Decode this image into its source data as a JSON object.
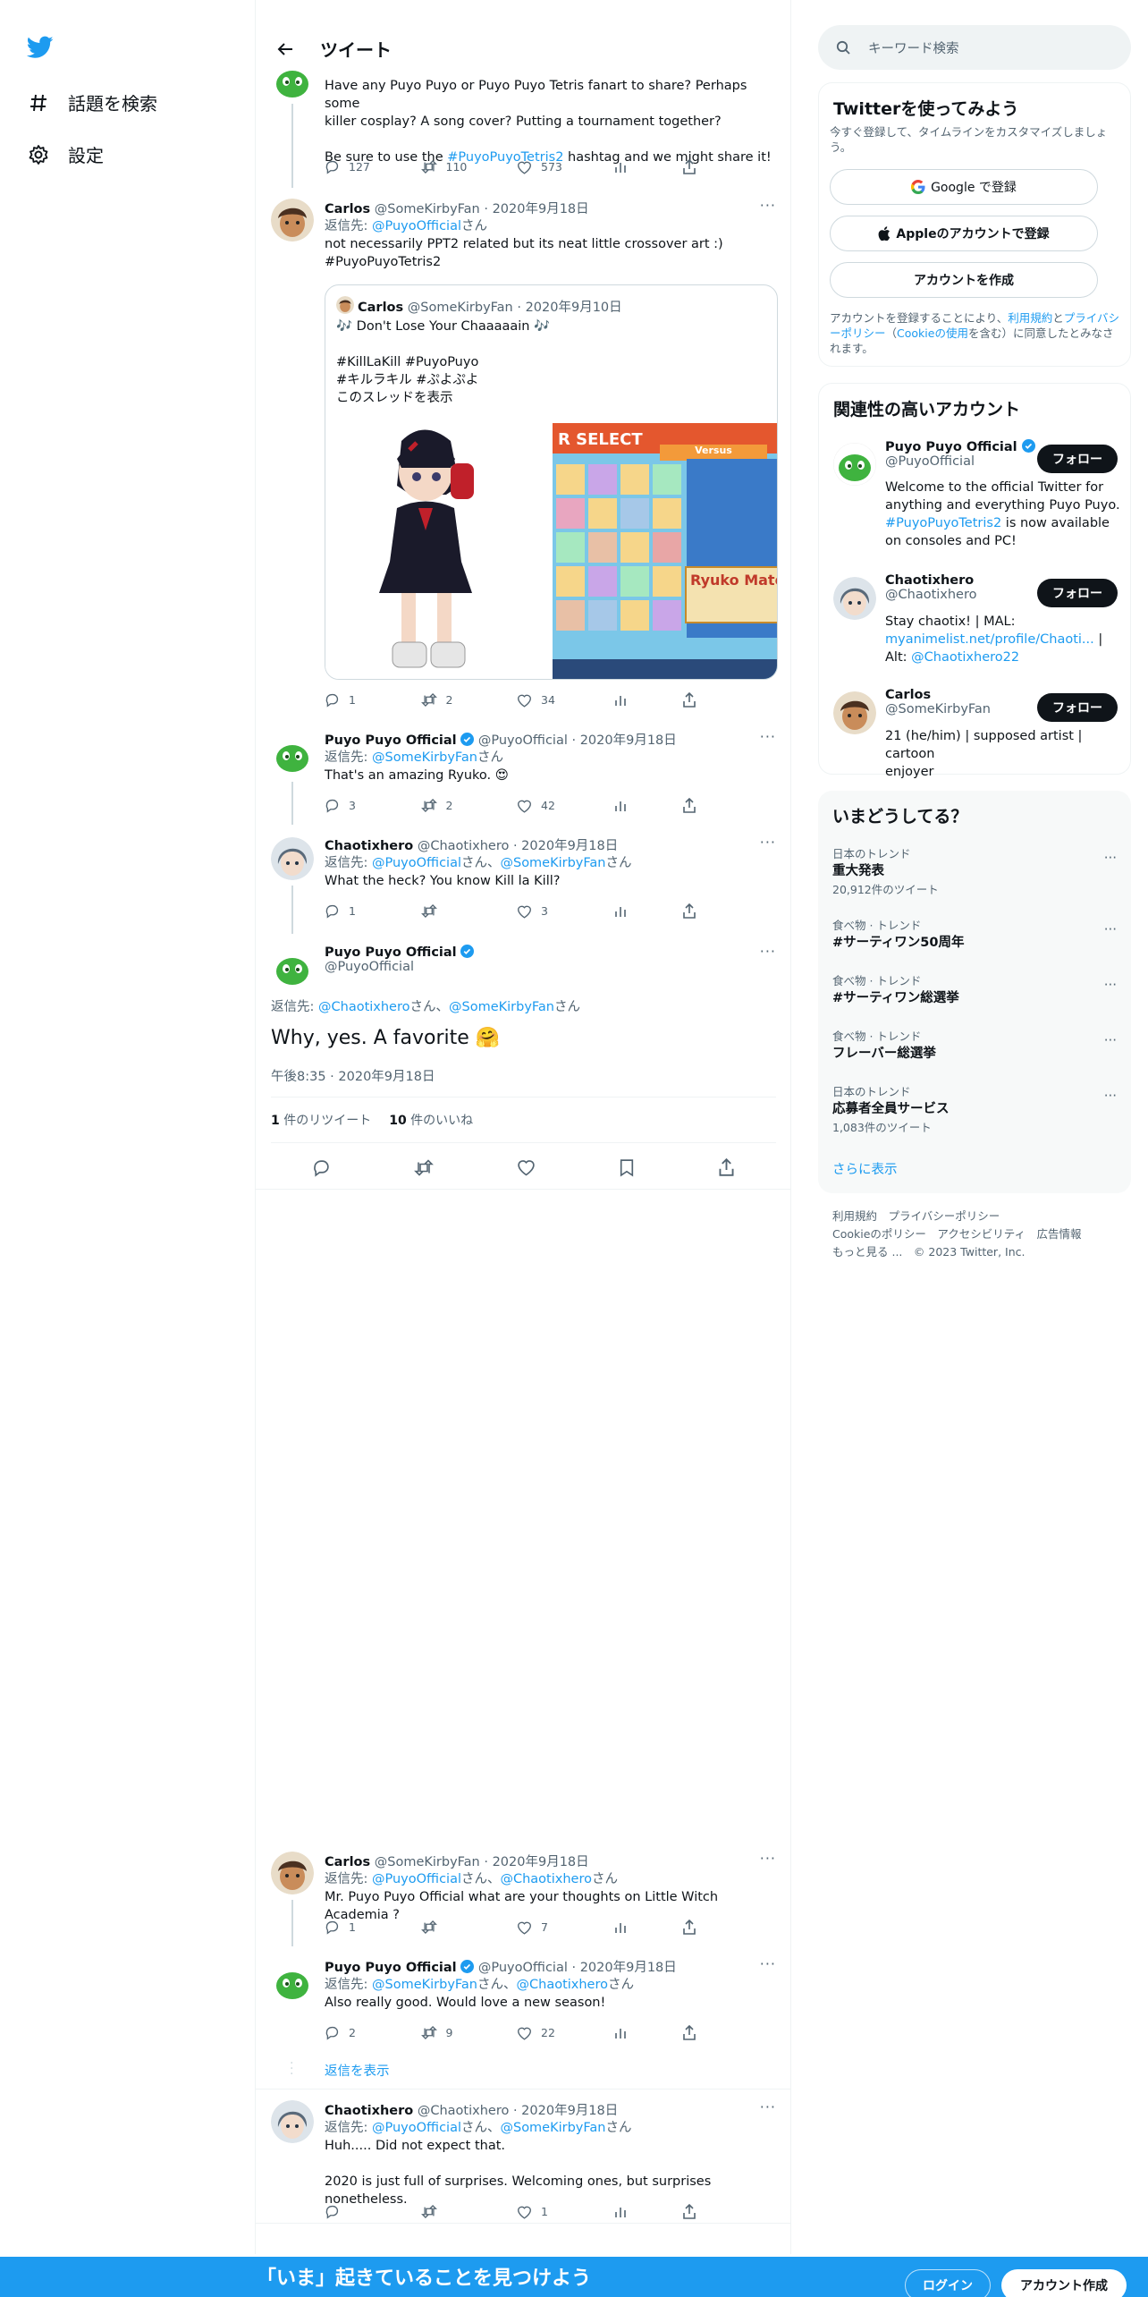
{
  "nav": {
    "explore": "話題を検索",
    "settings": "設定"
  },
  "header": {
    "title": "ツイート"
  },
  "tweets": {
    "t0": {
      "line1": "Have any Puyo Puyo or Puyo Puyo Tetris fanart to share? Perhaps some",
      "line2": "killer cosplay? A song cover? Putting a tournament together?",
      "line3a": "Be sure to use the ",
      "hashtag": "#PuyoPuyoTetris2",
      "line3b": " hashtag and we might share it!",
      "replies": "127",
      "retweets": "110",
      "likes": "573"
    },
    "t1": {
      "name": "Carlos",
      "handle": "@SomeKirbyFan",
      "date": "2020年9月18日",
      "reply_prefix": "返信先: ",
      "reply_to": "@PuyoOfficial",
      "reply_suffix": "さん",
      "text": "not necessarily PPT2 related but its neat little crossover art :)",
      "hashtag": "#PuyoPuyoTetris2",
      "quote": {
        "name": "Carlos",
        "handle": "@SomeKirbyFan",
        "date": "2020年9月10日",
        "line1": "🎶 Don't Lose Your Chaaaaain 🎶",
        "line2": "#KillLaKill #PuyoPuyo",
        "line3": "#キルラキル #ぷよぷよ",
        "thread": "このスレッドを表示",
        "img_select": "R SELECT",
        "img_versus": "Versus",
        "img_name": "Ryuko Mato"
      },
      "replies": "1",
      "retweets": "2",
      "likes": "34"
    },
    "t2": {
      "name": "Puyo Puyo Official",
      "handle": "@PuyoOfficial",
      "date": "2020年9月18日",
      "reply_prefix": "返信先: ",
      "reply_to": "@SomeKirbyFan",
      "reply_suffix": "さん",
      "text": "That's an amazing Ryuko. 😍",
      "replies": "3",
      "retweets": "2",
      "likes": "42"
    },
    "t3": {
      "name": "Chaotixhero",
      "handle": "@Chaotixhero",
      "date": "2020年9月18日",
      "reply_prefix": "返信先: ",
      "reply_to": "@PuyoOfficial",
      "sep": "さん、",
      "reply_to2": "@SomeKirbyFan",
      "reply_suffix": "さん",
      "text": "What the heck? You know Kill la Kill?",
      "replies": "1",
      "retweets": "",
      "likes": "3"
    },
    "main": {
      "name": "Puyo Puyo Official",
      "handle": "@PuyoOfficial",
      "reply_prefix": "返信先: ",
      "reply_to": "@Chaotixhero",
      "sep": "さん、",
      "reply_to2": "@SomeKirbyFan",
      "reply_suffix": "さん",
      "text": "Why, yes. A favorite 🤗",
      "time": "午後8:35 · 2020年9月18日",
      "rt_count": "1",
      "rt_label": "件のリツイート",
      "like_count": "10",
      "like_label": "件のいいね"
    },
    "t5": {
      "name": "Carlos",
      "handle": "@SomeKirbyFan",
      "date": "2020年9月18日",
      "reply_prefix": "返信先: ",
      "reply_to": "@PuyoOfficial",
      "sep": "さん、",
      "reply_to2": "@Chaotixhero",
      "reply_suffix": "さん",
      "text": "Mr. Puyo Puyo Official what are your thoughts on Little Witch Academia ?",
      "replies": "1",
      "retweets": "",
      "likes": "7"
    },
    "t6": {
      "name": "Puyo Puyo Official",
      "handle": "@PuyoOfficial",
      "date": "2020年9月18日",
      "reply_prefix": "返信先: ",
      "reply_to": "@SomeKirbyFan",
      "sep": "さん、",
      "reply_to2": "@Chaotixhero",
      "reply_suffix": "さん",
      "text": "Also really good. Would love a new season!",
      "replies": "2",
      "retweets": "9",
      "likes": "22",
      "show_replies": "返信を表示"
    },
    "t7": {
      "name": "Chaotixhero",
      "handle": "@Chaotixhero",
      "date": "2020年9月18日",
      "reply_prefix": "返信先: ",
      "reply_to": "@PuyoOfficial",
      "sep": "さん、",
      "reply_to2": "@SomeKirbyFan",
      "reply_suffix": "さん",
      "line1": "Huh..... Did not expect that.",
      "line2": "2020 is just full of surprises. Welcoming ones, but surprises nonetheless.",
      "replies": "",
      "retweets": "",
      "likes": "1"
    }
  },
  "search": {
    "placeholder": "キーワード検索"
  },
  "signup": {
    "title": "Twitterを使ってみよう",
    "subtitle": "今すぐ登録して、タイムラインをカスタマイズしましょう。",
    "google": "Google で登録",
    "apple": "Appleのアカウントで登録",
    "create": "アカウントを作成",
    "legal_a": "アカウントを登録することにより、",
    "terms": "利用規約",
    "and": "と",
    "privacy": "プライバシーポリシー",
    "cookie_open": "（",
    "cookie": "Cookieの使用",
    "legal_b": "を含む）に同意したとみなされます。"
  },
  "relevant": {
    "title": "関連性の高いアカウント",
    "follow": "フォロー",
    "a1": {
      "name": "Puyo Puyo Official",
      "handle": "@PuyoOfficial",
      "bio1": "Welcome to the official Twitter for",
      "bio2": "anything and everything Puyo Puyo.",
      "bio_tag": "#PuyoPuyoTetris2",
      "bio3": " is now available",
      "bio4": "on consoles and PC!"
    },
    "a2": {
      "name": "Chaotixhero",
      "handle": "@Chaotixhero",
      "bio1": "Stay chaotix! | MAL:",
      "bio_link": "myanimelist.net/profile/Chaoti...",
      "bio2": " |",
      "bio3": "Alt: ",
      "bio_alt": "@Chaotixhero22"
    },
    "a3": {
      "name": "Carlos",
      "handle": "@SomeKirbyFan",
      "bio1": "21 (he/him) | supposed artist | cartoon",
      "bio2": "enjoyer"
    }
  },
  "trends": {
    "title": "いまどうしてる？",
    "more": "さらに表示",
    "items": [
      {
        "cat": "日本のトレンド",
        "name": "重大発表",
        "count": "20,912件のツイート"
      },
      {
        "cat": "食べ物 · トレンド",
        "name": "#サーティワン50周年",
        "count": ""
      },
      {
        "cat": "食べ物 · トレンド",
        "name": "#サーティワン総選挙",
        "count": ""
      },
      {
        "cat": "食べ物 · トレンド",
        "name": "フレーバー総選挙",
        "count": ""
      },
      {
        "cat": "日本のトレンド",
        "name": "応募者全員サービス",
        "count": "1,083件のツイート"
      }
    ]
  },
  "footer": {
    "l1": "利用規約　プライバシーポリシー",
    "l2": "Cookieのポリシー　アクセシビリティ　広告情報",
    "more": "もっと見る ...",
    "copy": "© 2023 Twitter, Inc."
  },
  "banner": {
    "title": "「いま」起きていることを見つけよう",
    "login": "ログイン",
    "signup": "アカウント作成"
  },
  "colors": {
    "accent": "#1d9bf0",
    "text": "#0f1419",
    "muted": "#536471",
    "border": "#eff3f4"
  }
}
